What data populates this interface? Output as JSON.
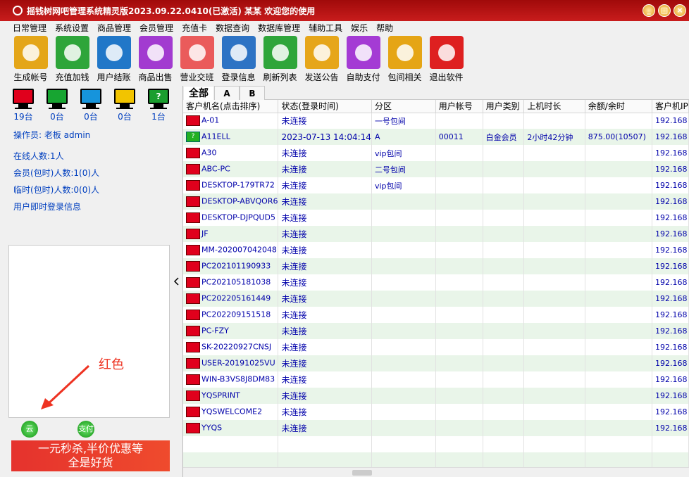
{
  "window": {
    "title": "摇钱树网吧管理系统精灵版2023.09.22.0410(已激活)  某某  欢迎您的使用",
    "controls": [
      "_",
      "□",
      "×"
    ]
  },
  "menu": [
    "日常管理",
    "系统设置",
    "商品管理",
    "会员管理",
    "充值卡",
    "数据查询",
    "数据库管理",
    "辅助工具",
    "娱乐",
    "帮助"
  ],
  "toolbar": [
    {
      "label": "生成帐号",
      "color": "#e4a619",
      "icon": "person-icon"
    },
    {
      "label": "充值加钱",
      "color": "#2ea53a",
      "icon": "piggy-bank-icon"
    },
    {
      "label": "用户结账",
      "color": "#2177c8",
      "icon": "dollar-bill-icon"
    },
    {
      "label": "商品出售",
      "color": "#a23bd0",
      "icon": "sale-tag-icon"
    },
    {
      "label": "营业交班",
      "color": "#ea5b5b",
      "icon": "shop-icon"
    },
    {
      "label": "登录信息",
      "color": "#2d73c4",
      "icon": "chat-icon"
    },
    {
      "label": "刷新列表",
      "color": "#2fa53a",
      "icon": "refresh-icon"
    },
    {
      "label": "发送公告",
      "color": "#e6a61a",
      "icon": "megaphone-icon"
    },
    {
      "label": "自助支付",
      "color": "#a43bd4",
      "icon": "yen-icon"
    },
    {
      "label": "包间相关",
      "color": "#e5a515",
      "icon": "person-icon"
    },
    {
      "label": "退出软件",
      "color": "#de2020",
      "icon": "power-icon"
    }
  ],
  "monitors": [
    {
      "color": "#e0001c",
      "count": "19台"
    },
    {
      "color": "#17a531",
      "count": "0台"
    },
    {
      "color": "#1694dc",
      "count": "0台"
    },
    {
      "color": "#f2c400",
      "count": "0台"
    },
    {
      "color": "#1a9e2e",
      "count": "1台",
      "symbol": "?"
    }
  ],
  "left_info": {
    "operator": "操作员:  老板 admin",
    "online": "在线人数:1人",
    "member": "会员(包时)人数:1(0)人",
    "temp": "临时(包时)人数:0(0)人",
    "realtime": "用户即时登录信息"
  },
  "annotation": "红色",
  "bottom_buttons": [
    "云",
    "支付"
  ],
  "ad": {
    "line1": "一元秒杀,半价优惠等",
    "line2": "全是好货"
  },
  "tabs": [
    "全部",
    "A",
    "B"
  ],
  "table": {
    "headers": [
      "客户机名(点击排序)",
      "状态(登录时间)",
      "分区",
      "用户帐号",
      "用户类别",
      "上机时长",
      "余额/余时",
      "客户机IP"
    ],
    "rows": [
      {
        "name": "A-01",
        "status": "未连接",
        "zone": "一号包间",
        "account": "",
        "type": "",
        "duration": "",
        "balance": "",
        "ip": "192.168"
      },
      {
        "name": "A11ELL",
        "status": "2023-07-13 14:04:14",
        "zone": "A",
        "account": "00011",
        "type": "白金会员",
        "duration": "2小时42分钟",
        "balance": "875.00(10507)",
        "ip": "192.168",
        "icon": "?"
      },
      {
        "name": "A30",
        "status": "未连接",
        "zone": "vip包间",
        "account": "",
        "type": "",
        "duration": "",
        "balance": "",
        "ip": "192.168"
      },
      {
        "name": "ABC-PC",
        "status": "未连接",
        "zone": "二号包间",
        "account": "",
        "type": "",
        "duration": "",
        "balance": "",
        "ip": "192.168"
      },
      {
        "name": "DESKTOP-179TR72",
        "status": "未连接",
        "zone": "vip包间",
        "account": "",
        "type": "",
        "duration": "",
        "balance": "",
        "ip": "192.168"
      },
      {
        "name": "DESKTOP-ABVQOR6",
        "status": "未连接",
        "zone": "",
        "account": "",
        "type": "",
        "duration": "",
        "balance": "",
        "ip": "192.168"
      },
      {
        "name": "DESKTOP-DJPQUD5",
        "status": "未连接",
        "zone": "",
        "account": "",
        "type": "",
        "duration": "",
        "balance": "",
        "ip": "192.168"
      },
      {
        "name": "JF",
        "status": "未连接",
        "zone": "",
        "account": "",
        "type": "",
        "duration": "",
        "balance": "",
        "ip": "192.168"
      },
      {
        "name": "MM-202007042048",
        "status": "未连接",
        "zone": "",
        "account": "",
        "type": "",
        "duration": "",
        "balance": "",
        "ip": "192.168"
      },
      {
        "name": "PC202101190933",
        "status": "未连接",
        "zone": "",
        "account": "",
        "type": "",
        "duration": "",
        "balance": "",
        "ip": "192.168"
      },
      {
        "name": "PC202105181038",
        "status": "未连接",
        "zone": "",
        "account": "",
        "type": "",
        "duration": "",
        "balance": "",
        "ip": "192.168"
      },
      {
        "name": "PC202205161449",
        "status": "未连接",
        "zone": "",
        "account": "",
        "type": "",
        "duration": "",
        "balance": "",
        "ip": "192.168"
      },
      {
        "name": "PC202209151518",
        "status": "未连接",
        "zone": "",
        "account": "",
        "type": "",
        "duration": "",
        "balance": "",
        "ip": "192.168"
      },
      {
        "name": "PC-FZY",
        "status": "未连接",
        "zone": "",
        "account": "",
        "type": "",
        "duration": "",
        "balance": "",
        "ip": "192.168"
      },
      {
        "name": "SK-20220927CNSJ",
        "status": "未连接",
        "zone": "",
        "account": "",
        "type": "",
        "duration": "",
        "balance": "",
        "ip": "192.168"
      },
      {
        "name": "USER-20191025VU",
        "status": "未连接",
        "zone": "",
        "account": "",
        "type": "",
        "duration": "",
        "balance": "",
        "ip": "192.168"
      },
      {
        "name": "WIN-B3VS8J8DM83",
        "status": "未连接",
        "zone": "",
        "account": "",
        "type": "",
        "duration": "",
        "balance": "",
        "ip": "192.168"
      },
      {
        "name": "YQSPRINT",
        "status": "未连接",
        "zone": "",
        "account": "",
        "type": "",
        "duration": "",
        "balance": "",
        "ip": "192.168"
      },
      {
        "name": "YQSWELCOME2",
        "status": "未连接",
        "zone": "",
        "account": "",
        "type": "",
        "duration": "",
        "balance": "",
        "ip": "192.168"
      },
      {
        "name": "YYQS",
        "status": "未连接",
        "zone": "",
        "account": "",
        "type": "",
        "duration": "",
        "balance": "",
        "ip": "192.168"
      }
    ]
  }
}
